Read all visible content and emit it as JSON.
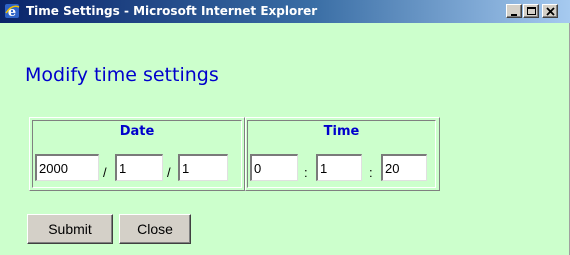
{
  "window": {
    "title": "Time Settings - Microsoft Internet Explorer",
    "icon": "internet-explorer-icon",
    "controls": [
      "minimize-icon",
      "maximize-icon",
      "close-icon"
    ]
  },
  "heading": "Modify time settings",
  "date": {
    "label": "Date",
    "year": "2000",
    "month": "1",
    "day": "1",
    "separator": "/"
  },
  "time": {
    "label": "Time",
    "hours": "0",
    "minutes": "1",
    "seconds": "20",
    "separator": ":"
  },
  "buttons": {
    "submit": "Submit",
    "close": "Close"
  },
  "colors": {
    "background": "#ccffcc",
    "accent_text": "#0000cc",
    "titlebar": "#0a246a"
  }
}
